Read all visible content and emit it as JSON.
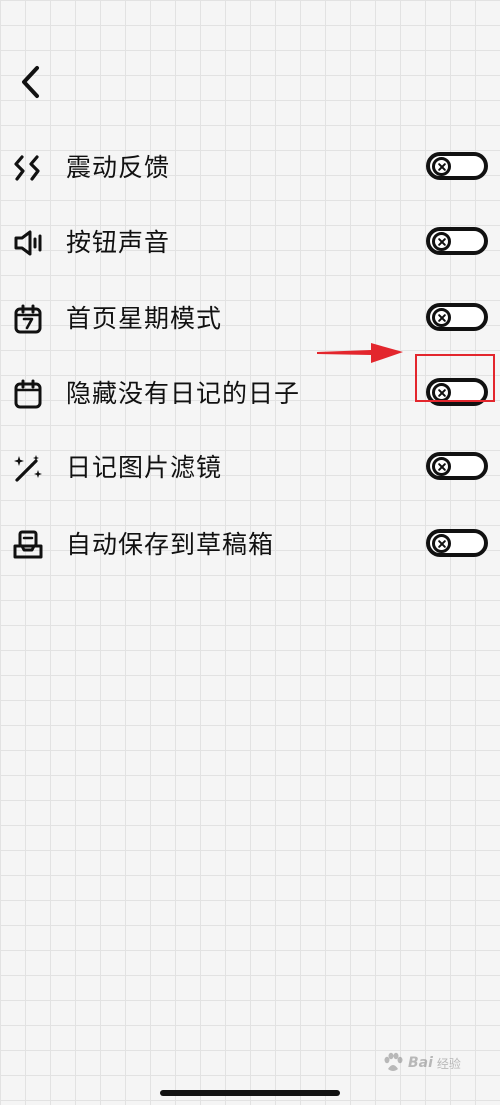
{
  "nav": {
    "back_icon": "chevron-left-icon"
  },
  "settings": [
    {
      "key": "vibration-feedback",
      "label": "震动反馈",
      "icon": "vibration-icon",
      "enabled": false
    },
    {
      "key": "button-sound",
      "label": "按钮声音",
      "icon": "speaker-icon",
      "enabled": false
    },
    {
      "key": "home-week-mode",
      "label": "首页星期模式",
      "icon": "calendar-7-icon",
      "enabled": false
    },
    {
      "key": "hide-empty-days",
      "label": "隐藏没有日记的日子",
      "icon": "calendar-icon",
      "enabled": false
    },
    {
      "key": "diary-image-filter",
      "label": "日记图片滤镜",
      "icon": "magic-wand-icon",
      "enabled": false
    },
    {
      "key": "autosave-drafts",
      "label": "自动保存到草稿箱",
      "icon": "drafts-tray-icon",
      "enabled": false
    }
  ],
  "annotation": {
    "highlight_color": "#e3262d",
    "highlighted_setting": "hide-empty-days"
  },
  "watermark": {
    "brand": "Bai",
    "text": "经验"
  },
  "colors": {
    "background": "#f5f5f5",
    "grid": "#e2e2e2",
    "ink": "#111111",
    "accent_red": "#e3262d"
  }
}
